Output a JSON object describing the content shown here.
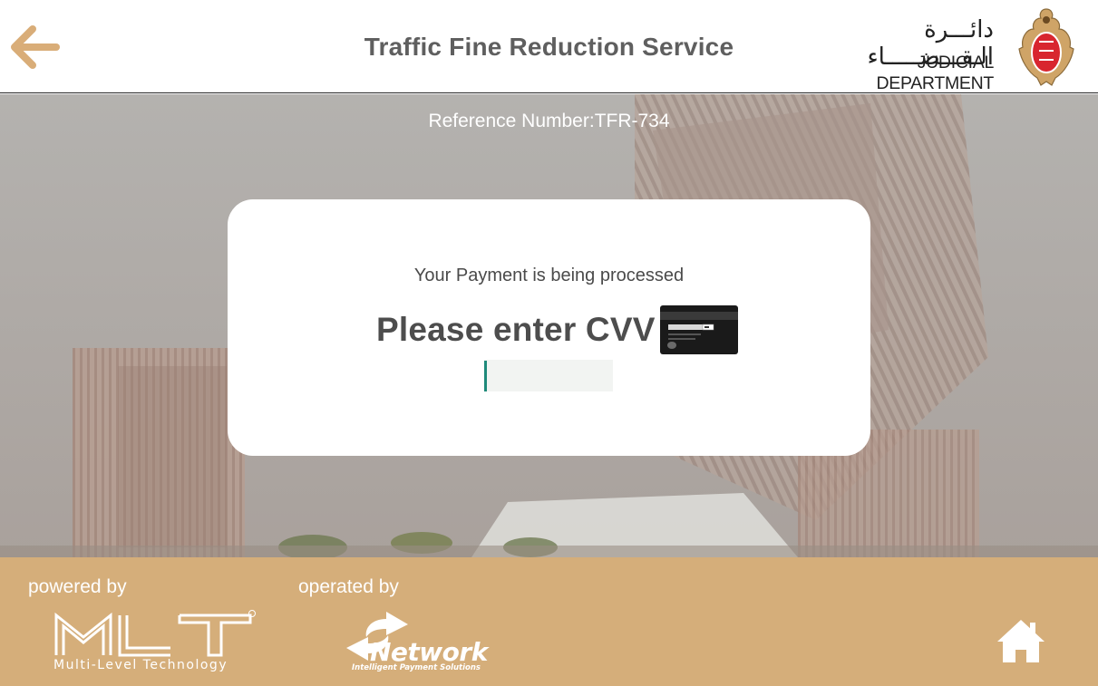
{
  "header": {
    "back_icon": "arrow-left-icon",
    "title": "Traffic Fine Reduction Service",
    "department_arabic": "دائـــرة الـقـــضـــــاء",
    "department_english": "JUDICIAL DEPARTMENT",
    "emblem_icon": "falcon-emblem-icon"
  },
  "reference": {
    "label": "Reference Number:",
    "value": "TFR-734"
  },
  "dialog": {
    "status_text": "Your Payment is being processed",
    "prompt": "Please enter CVV",
    "card_icon": "card-back-cvv-icon",
    "cvv_value": "",
    "cvv_placeholder": ""
  },
  "footer": {
    "powered_label": "powered by",
    "operated_label": "operated by",
    "mlt_logo_text": "MLT",
    "mlt_tagline": "Multi-Level Technology",
    "network_name": "Network",
    "network_tagline": "Intelligent Payment Solutions",
    "home_icon": "home-icon"
  },
  "colors": {
    "accent": "#d5ae7a",
    "back_arrow": "#d9ad78",
    "caret": "#1e8a7a",
    "title_text": "#5f5f5f"
  }
}
